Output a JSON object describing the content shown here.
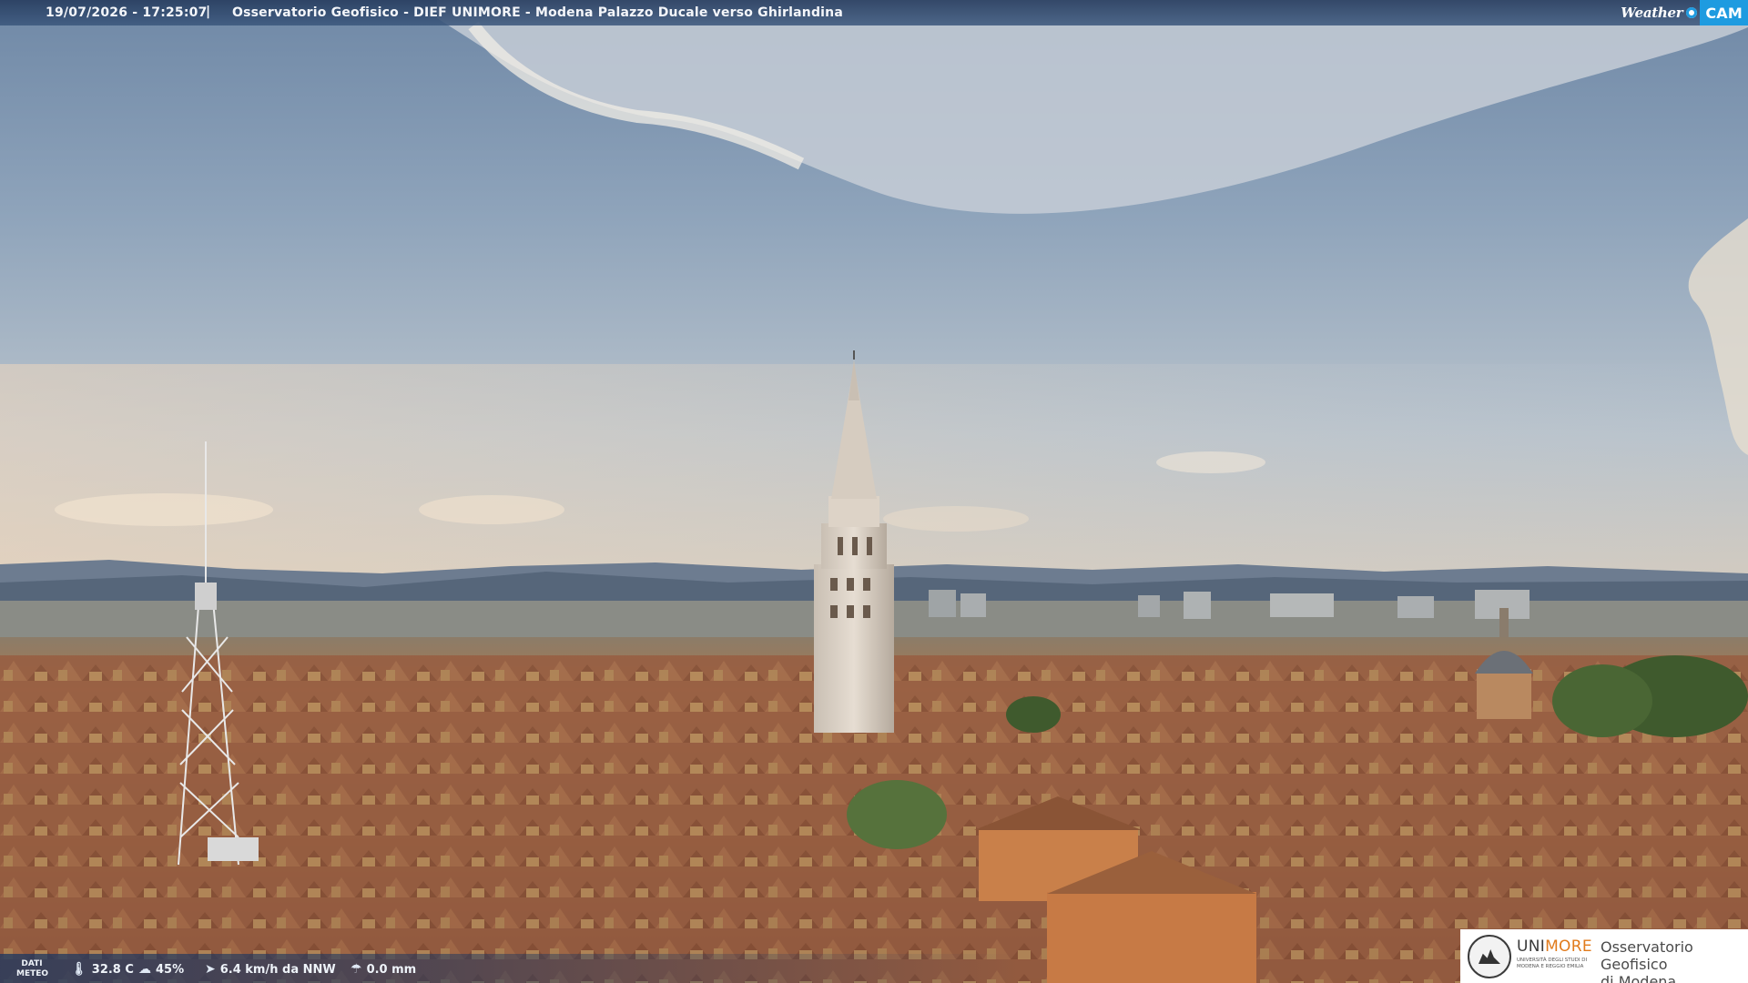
{
  "overlay": {
    "timestamp": "19/07/2026 - 17:25:07",
    "separator": "|",
    "title": "Osservatorio Geofisico - DIEF UNIMORE - Modena Palazzo Ducale verso Ghirlandina",
    "brand_weather": "Weather",
    "brand_cam": "CAM"
  },
  "weather": {
    "label_line1": "DATI",
    "label_line2": "METEO",
    "temperature": "32.8 C",
    "humidity": "45%",
    "wind": "6.4 km/h da NNW",
    "rain": "0.0 mm",
    "icons": [
      "thermometer-icon",
      "humidity-drop-icon",
      "wind-icon",
      "rain-gauge-icon"
    ]
  },
  "logo": {
    "uni_part1": "UNI",
    "uni_part2": "MORE",
    "uni_sub": "UNIVERSITÀ DEGLI STUDI DI MODENA E REGGIO EMILIA",
    "obs_line1": "Osservatorio Geofisico",
    "obs_line2": "di Modena"
  },
  "colors": {
    "bar": "#2f4c78",
    "brand_blue": "#1e9be0",
    "unimore_orange": "#e17b1c"
  }
}
